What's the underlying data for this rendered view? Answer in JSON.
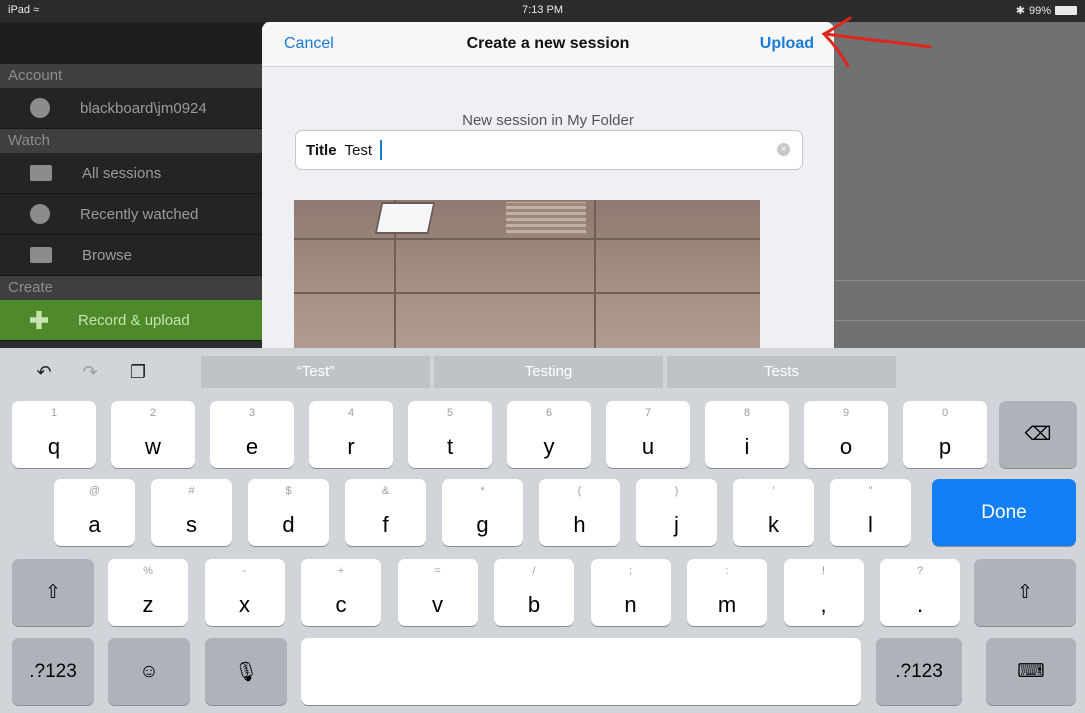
{
  "status_bar": {
    "carrier": "iPad",
    "wifi": "wifi-icon",
    "time": "7:13 PM",
    "bluetooth": "bluetooth-icon",
    "battery": "99%"
  },
  "sidebar": {
    "sections": [
      {
        "header": "Account",
        "items": [
          {
            "label": "blackboard\\jm0924",
            "icon": "user-icon"
          }
        ]
      },
      {
        "header": "Watch",
        "items": [
          {
            "label": "All sessions",
            "icon": "play-icon"
          },
          {
            "label": "Recently watched",
            "icon": "clock-icon"
          },
          {
            "label": "Browse",
            "icon": "folder-icon"
          }
        ]
      },
      {
        "header": "Create",
        "items": [
          {
            "label": "Record & upload",
            "icon": "plus-icon"
          }
        ]
      }
    ]
  },
  "modal": {
    "cancel_label": "Cancel",
    "title": "Create a new session",
    "upload_label": "Upload",
    "subtitle": "New session in My Folder",
    "title_field": {
      "label": "Title",
      "value": "Test"
    }
  },
  "keyboard": {
    "suggestions": [
      "“Test”",
      "Testing",
      "Tests"
    ],
    "row1": [
      [
        "1",
        "q"
      ],
      [
        "2",
        "w"
      ],
      [
        "3",
        "e"
      ],
      [
        "4",
        "r"
      ],
      [
        "5",
        "t"
      ],
      [
        "6",
        "y"
      ],
      [
        "7",
        "u"
      ],
      [
        "8",
        "i"
      ],
      [
        "9",
        "o"
      ],
      [
        "0",
        "p"
      ]
    ],
    "row2": [
      [
        "@",
        "a"
      ],
      [
        "#",
        "s"
      ],
      [
        "$",
        "d"
      ],
      [
        "&",
        "f"
      ],
      [
        "*",
        "g"
      ],
      [
        "(",
        "h"
      ],
      [
        ")",
        "j"
      ],
      [
        "'",
        "k"
      ],
      [
        "\"",
        "l"
      ]
    ],
    "row3": [
      [
        "%",
        "z"
      ],
      [
        "-",
        "x"
      ],
      [
        "+",
        "c"
      ],
      [
        "=",
        "v"
      ],
      [
        "/",
        "b"
      ],
      [
        ";",
        "n"
      ],
      [
        ":",
        "m"
      ],
      [
        "!",
        ","
      ],
      [
        "?",
        "."
      ]
    ],
    "done_label": "Done",
    "numbers_label": ".?123"
  },
  "colors": {
    "accent": "#147ef6",
    "link": "#1a7bd6",
    "annotation": "#e0251b",
    "sidebar_active": "#4e8a2a"
  }
}
